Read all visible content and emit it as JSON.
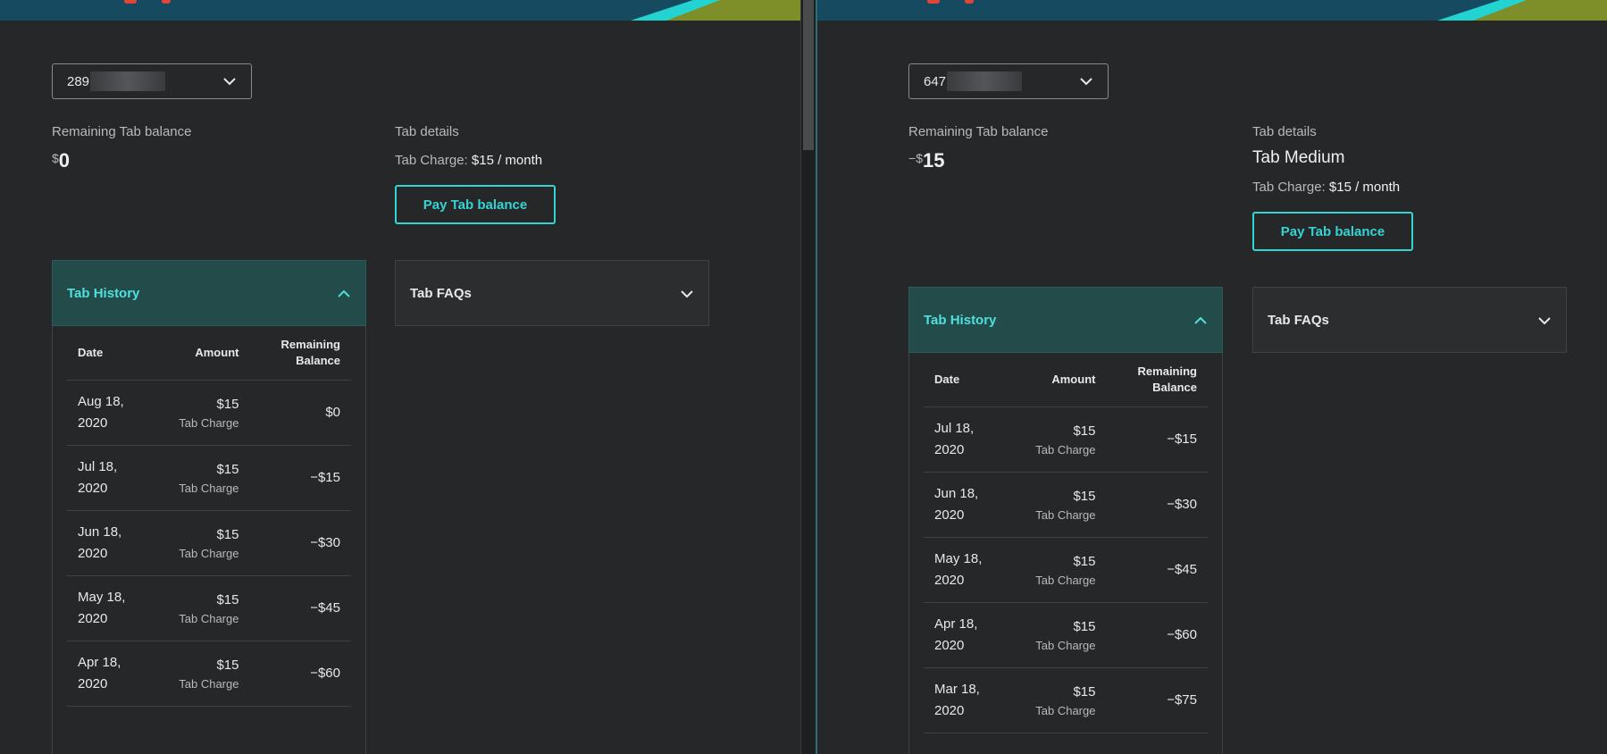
{
  "left": {
    "account_prefix": "289",
    "remaining_label": "Remaining Tab balance",
    "balance_sign": "",
    "balance_currency": "$",
    "balance_value": "0",
    "details_label": "Tab details",
    "plan_name": "",
    "charge_label": "Tab Charge:",
    "charge_value": "$15 / month",
    "pay_button": "Pay Tab balance",
    "history_title": "Tab History",
    "faq_title": "Tab FAQs",
    "columns": {
      "date": "Date",
      "amount": "Amount",
      "remaining_line1": "Remaining",
      "remaining_line2": "Balance"
    },
    "rows": [
      {
        "date": "Aug 18, 2020",
        "amount": "$15",
        "type": "Tab Charge",
        "remaining": "$0"
      },
      {
        "date": "Jul 18, 2020",
        "amount": "$15",
        "type": "Tab Charge",
        "remaining": "−$15"
      },
      {
        "date": "Jun 18, 2020",
        "amount": "$15",
        "type": "Tab Charge",
        "remaining": "−$30"
      },
      {
        "date": "May 18, 2020",
        "amount": "$15",
        "type": "Tab Charge",
        "remaining": "−$45"
      },
      {
        "date": "Apr 18, 2020",
        "amount": "$15",
        "type": "Tab Charge",
        "remaining": "−$60"
      }
    ]
  },
  "right": {
    "account_prefix": "647",
    "remaining_label": "Remaining Tab balance",
    "balance_sign": "−",
    "balance_currency": "$",
    "balance_value": "15",
    "details_label": "Tab details",
    "plan_name": "Tab Medium",
    "charge_label": "Tab Charge:",
    "charge_value": "$15 / month",
    "pay_button": "Pay Tab balance",
    "history_title": "Tab History",
    "faq_title": "Tab FAQs",
    "columns": {
      "date": "Date",
      "amount": "Amount",
      "remaining_line1": "Remaining",
      "remaining_line2": "Balance"
    },
    "rows": [
      {
        "date": "Jul 18, 2020",
        "amount": "$15",
        "type": "Tab Charge",
        "remaining": "−$15"
      },
      {
        "date": "Jun 18, 2020",
        "amount": "$15",
        "type": "Tab Charge",
        "remaining": "−$30"
      },
      {
        "date": "May 18, 2020",
        "amount": "$15",
        "type": "Tab Charge",
        "remaining": "−$45"
      },
      {
        "date": "Apr 18, 2020",
        "amount": "$15",
        "type": "Tab Charge",
        "remaining": "−$60"
      },
      {
        "date": "Mar 18, 2020",
        "amount": "$15",
        "type": "Tab Charge",
        "remaining": "−$75"
      }
    ]
  },
  "colors": {
    "accent": "#35d4d4",
    "open_header": "#234b49",
    "background": "#262729",
    "banner": "#154a60"
  },
  "icons": {
    "dropdown": "chevron-down-icon",
    "accordion_open": "chevron-up-icon",
    "accordion_closed": "chevron-down-icon"
  }
}
